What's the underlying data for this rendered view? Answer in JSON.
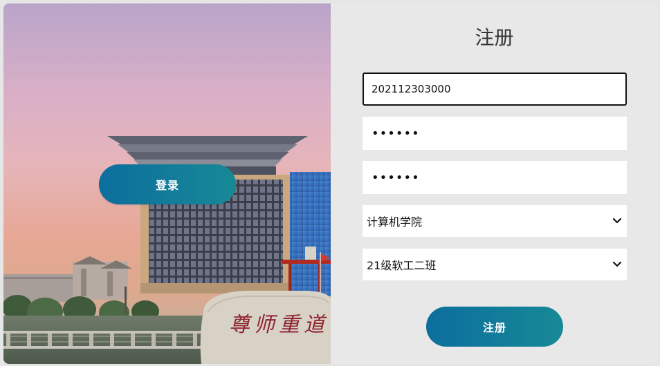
{
  "left_panel": {
    "login_label": "登录",
    "stone_inscription": "尊师重道"
  },
  "register_form": {
    "title": "注册",
    "student_id_value": "202112303000",
    "password_value": "••••••",
    "confirm_password_value": "••••••",
    "college_selected": "计算机学院",
    "class_selected": "21级软工二班",
    "submit_label": "注册"
  },
  "icons": {
    "select_arrow": "chevron-down-icon"
  },
  "colors": {
    "button_gradient_start": "#0c6e9e",
    "button_gradient_end": "#178996",
    "panel_background": "#e8e8e8"
  }
}
